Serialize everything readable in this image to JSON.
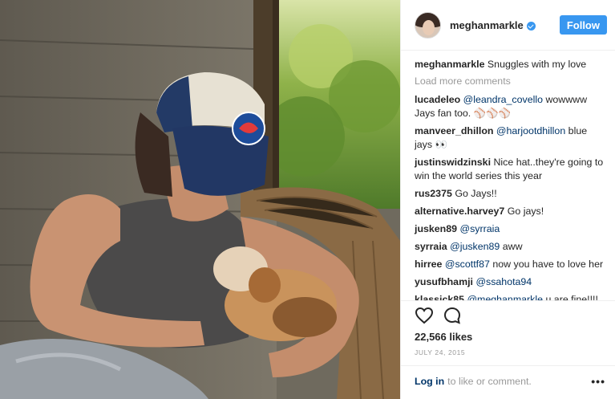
{
  "post": {
    "username": "meghanmarkle",
    "follow_label": "Follow",
    "caption": {
      "user": "meghanmarkle",
      "text": "Snuggles with my love"
    },
    "load_more": "Load more comments",
    "comments": [
      {
        "user": "lucadeleo",
        "mention": "@leandra_covello",
        "text": "wowwww Jays fan too. ⚾⚾⚾"
      },
      {
        "user": "manveer_dhillon",
        "mention": "@harjootdhillon",
        "text": "blue jays 👀"
      },
      {
        "user": "justinswidzinski",
        "mention": "",
        "text": "Nice hat..they're going to win the world series this year"
      },
      {
        "user": "rus2375",
        "mention": "",
        "text": "Go Jays!!"
      },
      {
        "user": "alternative.harvey7",
        "mention": "",
        "text": "Go jays!"
      },
      {
        "user": "jusken89",
        "mention": "@syrraia",
        "text": ""
      },
      {
        "user": "syrraia",
        "mention": "@jusken89",
        "text": "aww"
      },
      {
        "user": "hirree",
        "mention": "@scottf87",
        "text": "now you have to love her"
      },
      {
        "user": "yusufbhamji",
        "mention": "@ssahota94",
        "text": ""
      },
      {
        "user": "klassick85",
        "mention": "@meghanmarkle",
        "text": "u are fine!!!! Ru from Toronto?"
      }
    ],
    "likes": "22,566 likes",
    "date": "JULY 24, 2015",
    "login_link": "Log in",
    "login_rest": "to like or comment.",
    "more_label": "•••",
    "icons": {
      "like": "heart-icon",
      "comment": "comment-bubble-icon",
      "more": "more-options-icon",
      "verified": "verified-badge-icon"
    },
    "colors": {
      "accent": "#3897f0",
      "link": "#003569",
      "muted": "#999999"
    }
  }
}
